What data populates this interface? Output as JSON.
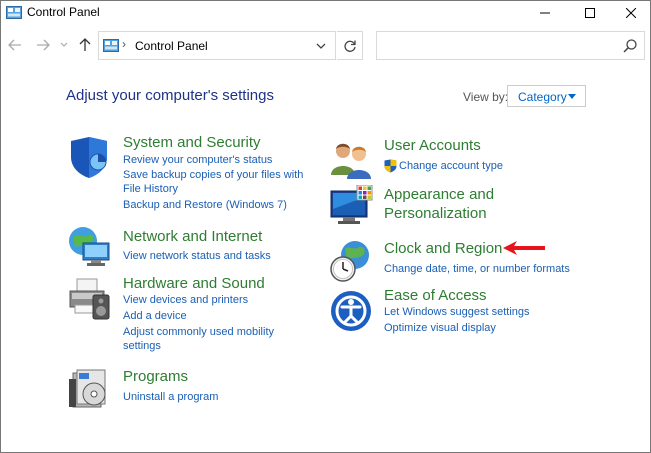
{
  "window": {
    "title": "Control Panel",
    "icon": "control-panel-icon",
    "controls": [
      "minimize-icon",
      "maximize-icon",
      "close-icon"
    ]
  },
  "address": {
    "separator": "›",
    "path": "Control Panel",
    "search_placeholder": ""
  },
  "main": {
    "heading": "Adjust your computer's settings",
    "view_by_label": "View by:",
    "view_by_value": "Category"
  },
  "categories": {
    "system_security": {
      "title": "System and Security",
      "icon": "shield-icon",
      "links": [
        "Review your computer's status",
        "Save backup copies of your files with File History",
        "Backup and Restore (Windows 7)"
      ]
    },
    "network": {
      "title": "Network and Internet",
      "icon": "network-globe-icon",
      "links": [
        "View network status and tasks"
      ]
    },
    "hardware": {
      "title": "Hardware and Sound",
      "icon": "printer-icon",
      "links": [
        "View devices and printers",
        "Add a device",
        "Adjust commonly used mobility settings"
      ]
    },
    "programs": {
      "title": "Programs",
      "icon": "programs-disc-icon",
      "links": [
        "Uninstall a program"
      ]
    },
    "user_accounts": {
      "title": "User Accounts",
      "icon": "users-icon",
      "links": [
        "Change account type"
      ]
    },
    "appearance": {
      "title": "Appearance and Personalization",
      "icon": "monitor-palette-icon",
      "links": []
    },
    "clock_region": {
      "title": "Clock and Region",
      "icon": "clock-globe-icon",
      "links": [
        "Change date, time, or number formats"
      ]
    },
    "ease_access": {
      "title": "Ease of Access",
      "icon": "ease-of-access-icon",
      "links": [
        "Let Windows suggest settings",
        "Optimize visual display"
      ]
    }
  },
  "annotation": {
    "icon": "red-arrow-icon",
    "color": "#e8141c"
  },
  "colors": {
    "heading": "#1e3287",
    "category_title": "#2e7d32",
    "link": "#1a5fb4"
  }
}
